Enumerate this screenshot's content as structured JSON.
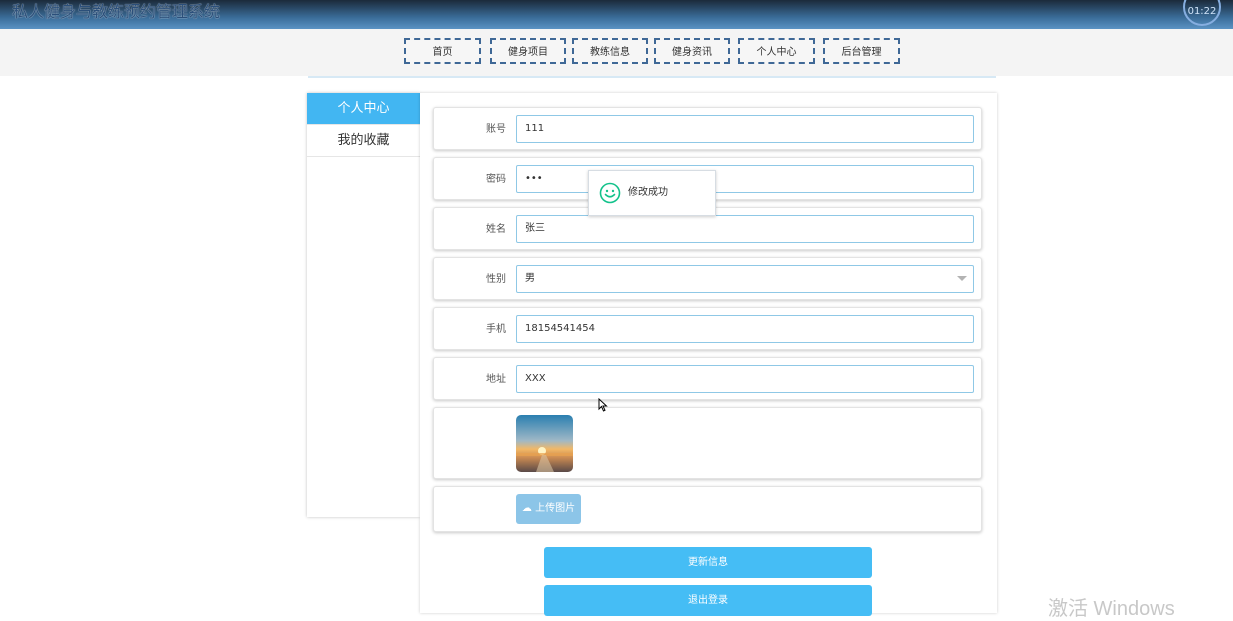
{
  "header": {
    "app_title": "私人健身与教练预约管理系统",
    "clock": "01:22"
  },
  "nav": {
    "items": [
      "首页",
      "健身项目",
      "教练信息",
      "健身资讯",
      "个人中心",
      "后台管理"
    ]
  },
  "sidebar": {
    "items": [
      {
        "label": "个人中心",
        "active": true
      },
      {
        "label": "我的收藏",
        "active": false
      }
    ]
  },
  "form": {
    "account": {
      "label": "账号",
      "value": "111"
    },
    "password": {
      "label": "密码",
      "value": "•••"
    },
    "name": {
      "label": "姓名",
      "value": "张三"
    },
    "gender": {
      "label": "性别",
      "value": "男"
    },
    "phone": {
      "label": "手机",
      "value": "18154541454"
    },
    "address": {
      "label": "地址",
      "value": "XXX"
    },
    "upload_label": "上传图片"
  },
  "actions": {
    "update": "更新信息",
    "logout": "退出登录"
  },
  "toast": {
    "message": "修改成功",
    "icon": "smile-icon"
  },
  "watermark": "激活 Windows",
  "colors": {
    "accent": "#45bdf5",
    "sidebar_active": "#42b6f2",
    "nav_border": "#3f6896",
    "toast_icon": "#13c28b"
  }
}
